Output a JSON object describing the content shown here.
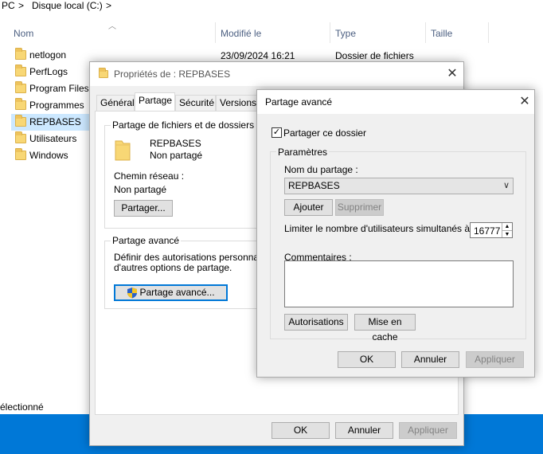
{
  "explorer": {
    "breadcrumb": {
      "root": "PC",
      "sep1": ">",
      "drive": "Disque local (C:)",
      "sep2": ">"
    },
    "columns": {
      "name": "Nom",
      "modified": "Modifié le",
      "type": "Type",
      "size": "Taille"
    },
    "first_row": {
      "modified": "23/09/2024 16:21",
      "type": "Dossier de fichiers"
    },
    "files": [
      "netlogon",
      "PerfLogs",
      "Program Files",
      "Programmes",
      "REPBASES",
      "Utilisateurs",
      "Windows"
    ],
    "selected_file": "REPBASES",
    "status": "électionné"
  },
  "props": {
    "title": "Propriétés de : REPBASES",
    "tabs": [
      "Général",
      "Partage",
      "Sécurité",
      "Versions p"
    ],
    "active_tab": "Partage",
    "sharing_group_title": "Partage de fichiers et de dossiers en ré",
    "folder_name": "REPBASES",
    "folder_state": "Non partagé",
    "network_path_label": "Chemin réseau :",
    "network_path_value": "Non partagé",
    "share_button": "Partager...",
    "advanced_group_title": "Partage avancé",
    "advanced_desc_line1": "Définir des autorisations personnalisée",
    "advanced_desc_line2": "d'autres options de partage.",
    "advanced_button": "Partage avancé...",
    "ok": "OK",
    "cancel": "Annuler",
    "apply": "Appliquer"
  },
  "advanced": {
    "title": "Partage avancé",
    "share_checkbox_label": "Partager ce dossier",
    "share_checked": true,
    "params_title": "Paramètres",
    "share_name_label": "Nom du partage :",
    "share_name_value": "REPBASES",
    "add_button": "Ajouter",
    "remove_button": "Supprimer",
    "limit_label": "Limiter le nombre d'utilisateurs simultanés à :",
    "limit_value": "16777",
    "comments_label": "Commentaires :",
    "comments_value": "",
    "permissions_button": "Autorisations",
    "caching_button": "Mise en cache",
    "ok": "OK",
    "cancel": "Annuler",
    "apply": "Appliquer"
  },
  "colors": {
    "selection": "#cce8ff",
    "taskbar": "#0078d7",
    "folder": "#f8d775",
    "focus_border": "#0078d7"
  }
}
